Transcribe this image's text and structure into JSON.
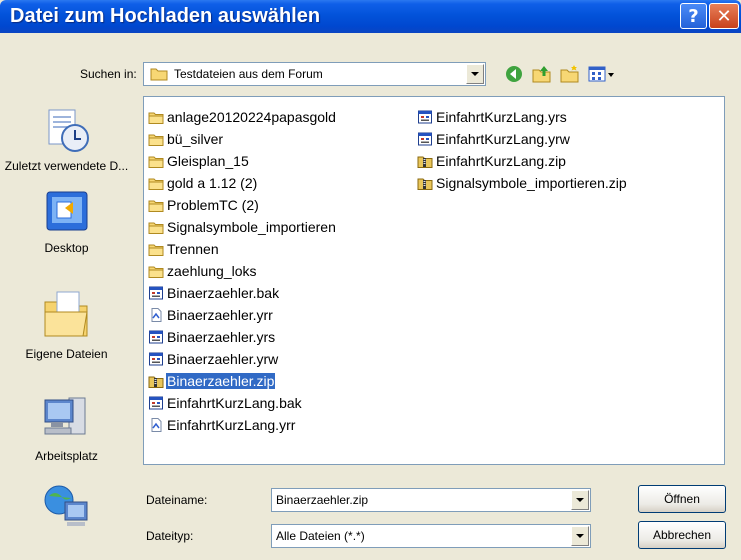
{
  "window": {
    "title": "Datei zum Hochladen auswählen"
  },
  "titlebar": {
    "help_icon": "help-icon",
    "close_icon": "close-icon",
    "help_glyph": "?",
    "close_glyph": "✕"
  },
  "lookin": {
    "label": "Suchen in:",
    "value": "Testdateien aus dem Forum"
  },
  "places": [
    {
      "label": "Zuletzt verwendete D...",
      "icon": "recent-documents-icon"
    },
    {
      "label": "Desktop",
      "icon": "desktop-icon"
    },
    {
      "label": "Eigene Dateien",
      "icon": "my-documents-icon"
    },
    {
      "label": "Arbeitsplatz",
      "icon": "my-computer-icon"
    },
    {
      "label": "",
      "icon": "network-places-icon"
    }
  ],
  "files": {
    "column1": [
      {
        "name": "anlage20120224papasgold",
        "type": "folder"
      },
      {
        "name": "bü_silver",
        "type": "folder"
      },
      {
        "name": "Gleisplan_15",
        "type": "folder"
      },
      {
        "name": "gold  a 1.12 (2)",
        "type": "folder"
      },
      {
        "name": "ProblemTC (2)",
        "type": "folder"
      },
      {
        "name": "Signalsymbole_importieren",
        "type": "folder"
      },
      {
        "name": "Trennen",
        "type": "folder"
      },
      {
        "name": "zaehlung_loks",
        "type": "folder"
      },
      {
        "name": "Binaerzaehler.bak",
        "type": "app"
      },
      {
        "name": "Binaerzaehler.yrr",
        "type": "script"
      },
      {
        "name": "Binaerzaehler.yrs",
        "type": "app"
      },
      {
        "name": "Binaerzaehler.yrw",
        "type": "app"
      },
      {
        "name": "Binaerzaehler.zip",
        "type": "zip",
        "selected": true
      },
      {
        "name": "EinfahrtKurzLang.bak",
        "type": "app"
      },
      {
        "name": "EinfahrtKurzLang.yrr",
        "type": "script"
      }
    ],
    "column2": [
      {
        "name": "EinfahrtKurzLang.yrs",
        "type": "app"
      },
      {
        "name": "EinfahrtKurzLang.yrw",
        "type": "app"
      },
      {
        "name": "EinfahrtKurzLang.zip",
        "type": "zip"
      },
      {
        "name": "Signalsymbole_importieren.zip",
        "type": "zip"
      }
    ]
  },
  "filename": {
    "label": "Dateiname:",
    "value": "Binaerzaehler.zip"
  },
  "filetype": {
    "label": "Dateityp:",
    "value": "Alle Dateien (*.*)"
  },
  "buttons": {
    "open": "Öffnen",
    "cancel": "Abbrechen"
  },
  "colors": {
    "selection": "#316AC5",
    "titlebar": "#0353DA",
    "dialog_bg": "#ECE9D8"
  }
}
